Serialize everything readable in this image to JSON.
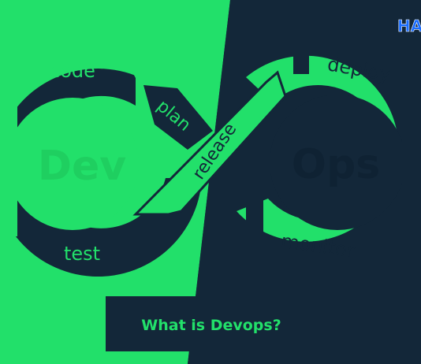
{
  "brand": {
    "logo_text": "HA"
  },
  "infinity_loop": {
    "left_label": "Dev",
    "right_label": "Ops",
    "stages": {
      "code": "code",
      "plan": "plan",
      "test": "test",
      "release": "release",
      "deploy": "deploy",
      "monitor": "monitor"
    }
  },
  "caption": {
    "title": "What is Devops?"
  },
  "colors": {
    "green": "#22e06a",
    "navy": "#132739",
    "bright_blue": "#1a6cff"
  }
}
